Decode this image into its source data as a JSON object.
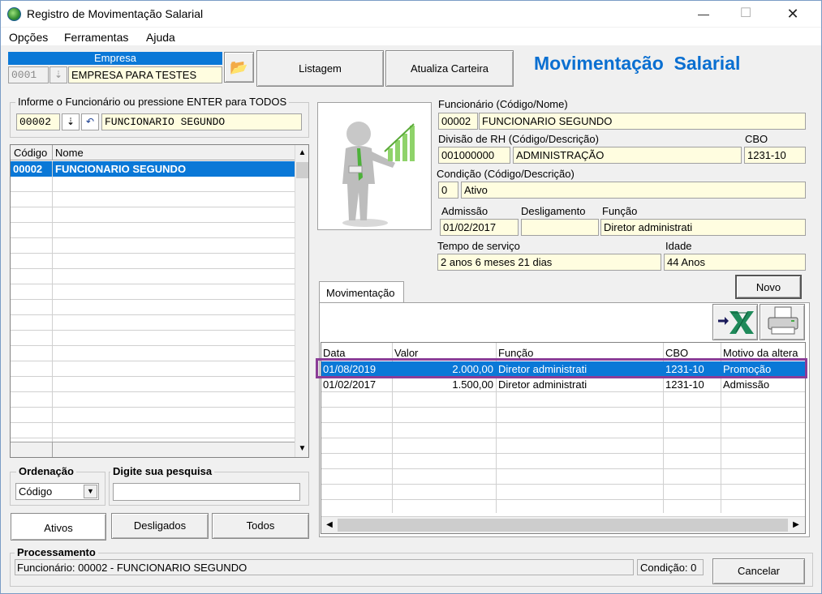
{
  "window": {
    "title": "Registro de Movimentação Salarial",
    "minimize": "—",
    "maximize": "☐",
    "close": "✕"
  },
  "menu": [
    {
      "label": "Opções"
    },
    {
      "label": "Ferramentas"
    },
    {
      "label": "Ajuda"
    }
  ],
  "empresa": {
    "header": "Empresa",
    "code": "0001",
    "name": "EMPRESA PARA TESTES"
  },
  "toolbar": {
    "listagem": "Listagem",
    "atualiza": "Atualiza Carteira",
    "app_title": "Movimentação  Salarial"
  },
  "search": {
    "group_title": "Informe o Funcionário ou pressione ENTER para TODOS",
    "code": "00002",
    "name": "FUNCIONARIO SEGUNDO"
  },
  "list": {
    "columns": [
      "Código",
      "Nome"
    ],
    "rows": [
      {
        "code": "00002",
        "name": "FUNCIONARIO SEGUNDO"
      }
    ]
  },
  "ordenacao": {
    "label": "Ordenação",
    "value": "Código"
  },
  "pesquisa": {
    "label": "Digite sua pesquisa",
    "value": ""
  },
  "filters": {
    "ativos": "Ativos",
    "desligados": "Desligados",
    "todos": "Todos"
  },
  "employee": {
    "func_label": "Funcionário (Código/Nome)",
    "func_code": "00002",
    "func_name": "FUNCIONARIO SEGUNDO",
    "div_label": "Divisão de RH (Código/Descrição)",
    "div_code": "001000000",
    "div_name": "ADMINISTRAÇÃO",
    "cbo_label": "CBO",
    "cbo": "1231-10",
    "cond_label": "Condição (Código/Descrição)",
    "cond_code": "0",
    "cond_name": "Ativo",
    "adm_label": "Admissão",
    "adm": "01/02/2017",
    "desl_label": "Desligamento",
    "desl": "",
    "funcao_label": "Função",
    "funcao": "Diretor administrati",
    "tempo_label": "Tempo de serviço",
    "tempo": "2 anos 6 meses 21 dias",
    "idade_label": "Idade",
    "idade": "44 Anos"
  },
  "tab": {
    "label": "Movimentação"
  },
  "novo": "Novo",
  "mov": {
    "columns": [
      "Data",
      "Valor",
      "Função",
      "CBO",
      "Motivo da altera"
    ],
    "rows": [
      {
        "data": "01/08/2019",
        "valor": "2.000,00",
        "funcao": "Diretor administrati",
        "cbo": "1231-10",
        "motivo": "Promoção"
      },
      {
        "data": "01/02/2017",
        "valor": "1.500,00",
        "funcao": "Diretor administrati",
        "cbo": "1231-10",
        "motivo": "Admissão"
      }
    ]
  },
  "processamento": {
    "label": "Processamento",
    "text": "Funcionário: 00002 - FUNCIONARIO SEGUNDO",
    "condicao": "Condição: 0"
  },
  "cancelar": "Cancelar",
  "colors": {
    "selection": "#0a78d7",
    "highlight_border": "#8b3d97",
    "title_blue": "#0a6fd1",
    "field_bg": "#fffde0"
  }
}
